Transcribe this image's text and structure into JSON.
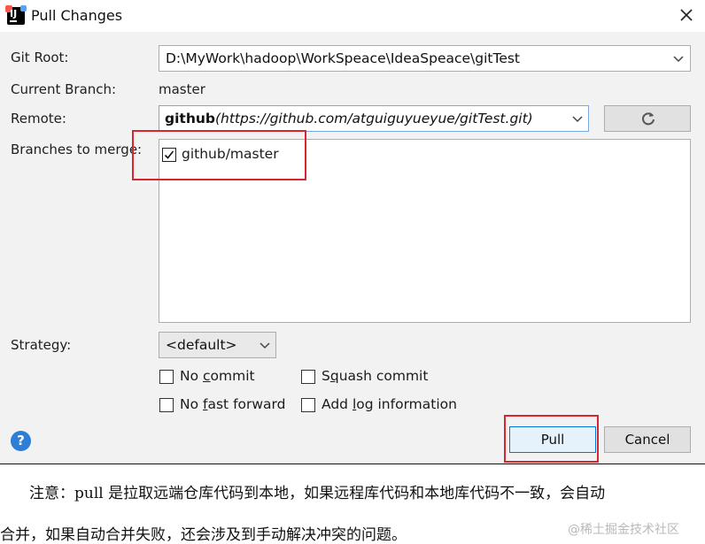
{
  "window": {
    "title": "Pull Changes"
  },
  "form": {
    "git_root_label": "Git Root:",
    "git_root_value": "D:\\MyWork\\hadoop\\WorkSpeace\\IdeaSpeace\\gitTest",
    "current_branch_label": "Current Branch:",
    "current_branch_value": "master",
    "remote_label": "Remote:",
    "remote_name": "github",
    "remote_url": "(https://github.com/atguiguyueyue/gitTest.git)",
    "branches_label": "Branches to merge:",
    "branches": [
      {
        "label": "github/master",
        "checked": true
      }
    ],
    "strategy_label": "Strategy:",
    "strategy_value": "<default>",
    "options": {
      "no_commit_pre": "No ",
      "no_commit_mn": "c",
      "no_commit_post": "ommit",
      "squash_pre": "S",
      "squash_mn": "q",
      "squash_post": "uash commit",
      "no_ff_pre": "No ",
      "no_ff_mn": "f",
      "no_ff_post": "ast forward",
      "add_log_pre": "Add ",
      "add_log_mn": "l",
      "add_log_post": "og information",
      "states": {
        "no_commit": false,
        "squash": false,
        "no_fast_forward": false,
        "add_log": false
      }
    }
  },
  "buttons": {
    "pull": "Pull",
    "cancel": "Cancel",
    "help": "?"
  },
  "icons": {
    "app": "intellij-icon",
    "close": "close-icon",
    "refresh": "refresh-icon",
    "help": "help-icon"
  },
  "note": {
    "line1": "注意：pull 是拉取远端仓库代码到本地，如果远程库代码和本地库代码不一致，会自动",
    "line2": "合并，如果自动合并失败，还会涉及到手动解决冲突的问题。"
  },
  "watermark": "@稀土掘金技术社区",
  "colors": {
    "highlight": "#d9262e",
    "help_blue": "#2d7ed6",
    "dialog_bg": "#f2f2f2"
  }
}
